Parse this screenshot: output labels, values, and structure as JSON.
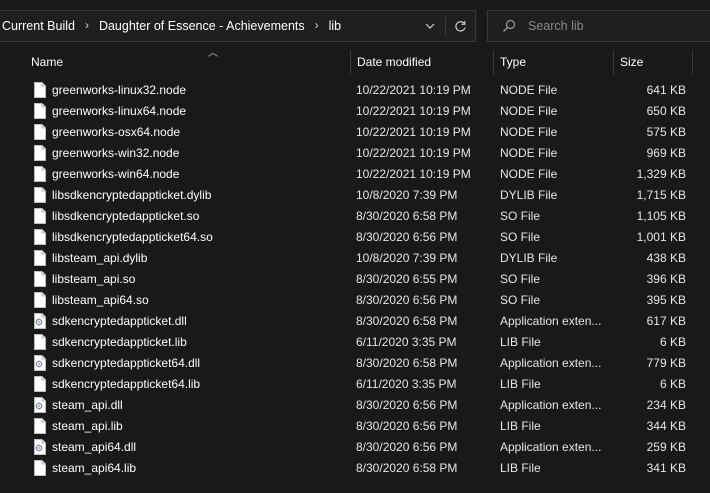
{
  "breadcrumb": {
    "items": [
      "Current Build",
      "Daughter of Essence - Achievements",
      "lib"
    ],
    "separator": "›"
  },
  "search": {
    "placeholder": "Search lib"
  },
  "columns": {
    "name": "Name",
    "date": "Date modified",
    "type": "Type",
    "size": "Size"
  },
  "icons": {
    "dropdown": "chevron-down-icon",
    "refresh": "refresh-icon",
    "search": "search-icon",
    "file": "file-icon",
    "dll": "gear-file-icon"
  },
  "files": [
    {
      "name": "greenworks-linux32.node",
      "date": "10/22/2021 10:19 PM",
      "type": "NODE File",
      "size": "641 KB",
      "icon": "file"
    },
    {
      "name": "greenworks-linux64.node",
      "date": "10/22/2021 10:19 PM",
      "type": "NODE File",
      "size": "650 KB",
      "icon": "file"
    },
    {
      "name": "greenworks-osx64.node",
      "date": "10/22/2021 10:19 PM",
      "type": "NODE File",
      "size": "575 KB",
      "icon": "file"
    },
    {
      "name": "greenworks-win32.node",
      "date": "10/22/2021 10:19 PM",
      "type": "NODE File",
      "size": "969 KB",
      "icon": "file"
    },
    {
      "name": "greenworks-win64.node",
      "date": "10/22/2021 10:19 PM",
      "type": "NODE File",
      "size": "1,329 KB",
      "icon": "file"
    },
    {
      "name": "libsdkencryptedappticket.dylib",
      "date": "10/8/2020 7:39 PM",
      "type": "DYLIB File",
      "size": "1,715 KB",
      "icon": "file"
    },
    {
      "name": "libsdkencryptedappticket.so",
      "date": "8/30/2020 6:58 PM",
      "type": "SO File",
      "size": "1,105 KB",
      "icon": "file"
    },
    {
      "name": "libsdkencryptedappticket64.so",
      "date": "8/30/2020 6:56 PM",
      "type": "SO File",
      "size": "1,001 KB",
      "icon": "file"
    },
    {
      "name": "libsteam_api.dylib",
      "date": "10/8/2020 7:39 PM",
      "type": "DYLIB File",
      "size": "438 KB",
      "icon": "file"
    },
    {
      "name": "libsteam_api.so",
      "date": "8/30/2020 6:55 PM",
      "type": "SO File",
      "size": "396 KB",
      "icon": "file"
    },
    {
      "name": "libsteam_api64.so",
      "date": "8/30/2020 6:56 PM",
      "type": "SO File",
      "size": "395 KB",
      "icon": "file"
    },
    {
      "name": "sdkencryptedappticket.dll",
      "date": "8/30/2020 6:58 PM",
      "type": "Application exten...",
      "size": "617 KB",
      "icon": "dll"
    },
    {
      "name": "sdkencryptedappticket.lib",
      "date": "6/11/2020 3:35 PM",
      "type": "LIB File",
      "size": "6 KB",
      "icon": "file"
    },
    {
      "name": "sdkencryptedappticket64.dll",
      "date": "8/30/2020 6:58 PM",
      "type": "Application exten...",
      "size": "779 KB",
      "icon": "dll"
    },
    {
      "name": "sdkencryptedappticket64.lib",
      "date": "6/11/2020 3:35 PM",
      "type": "LIB File",
      "size": "6 KB",
      "icon": "file"
    },
    {
      "name": "steam_api.dll",
      "date": "8/30/2020 6:56 PM",
      "type": "Application exten...",
      "size": "234 KB",
      "icon": "dll"
    },
    {
      "name": "steam_api.lib",
      "date": "8/30/2020 6:56 PM",
      "type": "LIB File",
      "size": "344 KB",
      "icon": "file"
    },
    {
      "name": "steam_api64.dll",
      "date": "8/30/2020 6:56 PM",
      "type": "Application exten...",
      "size": "259 KB",
      "icon": "dll"
    },
    {
      "name": "steam_api64.lib",
      "date": "8/30/2020 6:58 PM",
      "type": "LIB File",
      "size": "341 KB",
      "icon": "file"
    }
  ]
}
